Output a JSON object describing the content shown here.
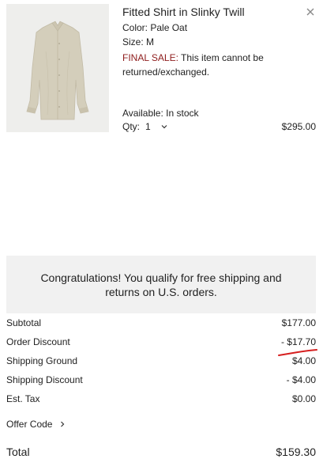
{
  "cart_item": {
    "title": "Fitted Shirt in Slinky Twill",
    "color": "Color: Pale Oat",
    "size": "Size: M",
    "final_sale_label": "FINAL SALE:",
    "final_sale_text": " This item cannot be returned/exchanged.",
    "availability": "Available: In stock",
    "qty_label": "Qty:",
    "qty_value": "1",
    "price": "$295.00",
    "image_icon": "shirt-image",
    "close_icon": "close-icon"
  },
  "promo": {
    "message": "Congratulations! You qualify for free shipping and returns on U.S. orders."
  },
  "summary": {
    "subtotal_label": "Subtotal",
    "subtotal_value": "$177.00",
    "discount_label": "Order Discount",
    "discount_value": "- $17.70",
    "shipping_label": "Shipping Ground",
    "shipping_value": "$4.00",
    "shipping_discount_label": "Shipping Discount",
    "shipping_discount_value": "- $4.00",
    "tax_label": "Est. Tax",
    "tax_value": "$0.00",
    "offer_code_label": "Offer Code",
    "total_label": "Total",
    "total_value": "$159.30"
  },
  "colors": {
    "final_sale": "#8e1c1c",
    "annotation_underline": "#d61f1f",
    "banner_bg": "#f1f1f1"
  }
}
